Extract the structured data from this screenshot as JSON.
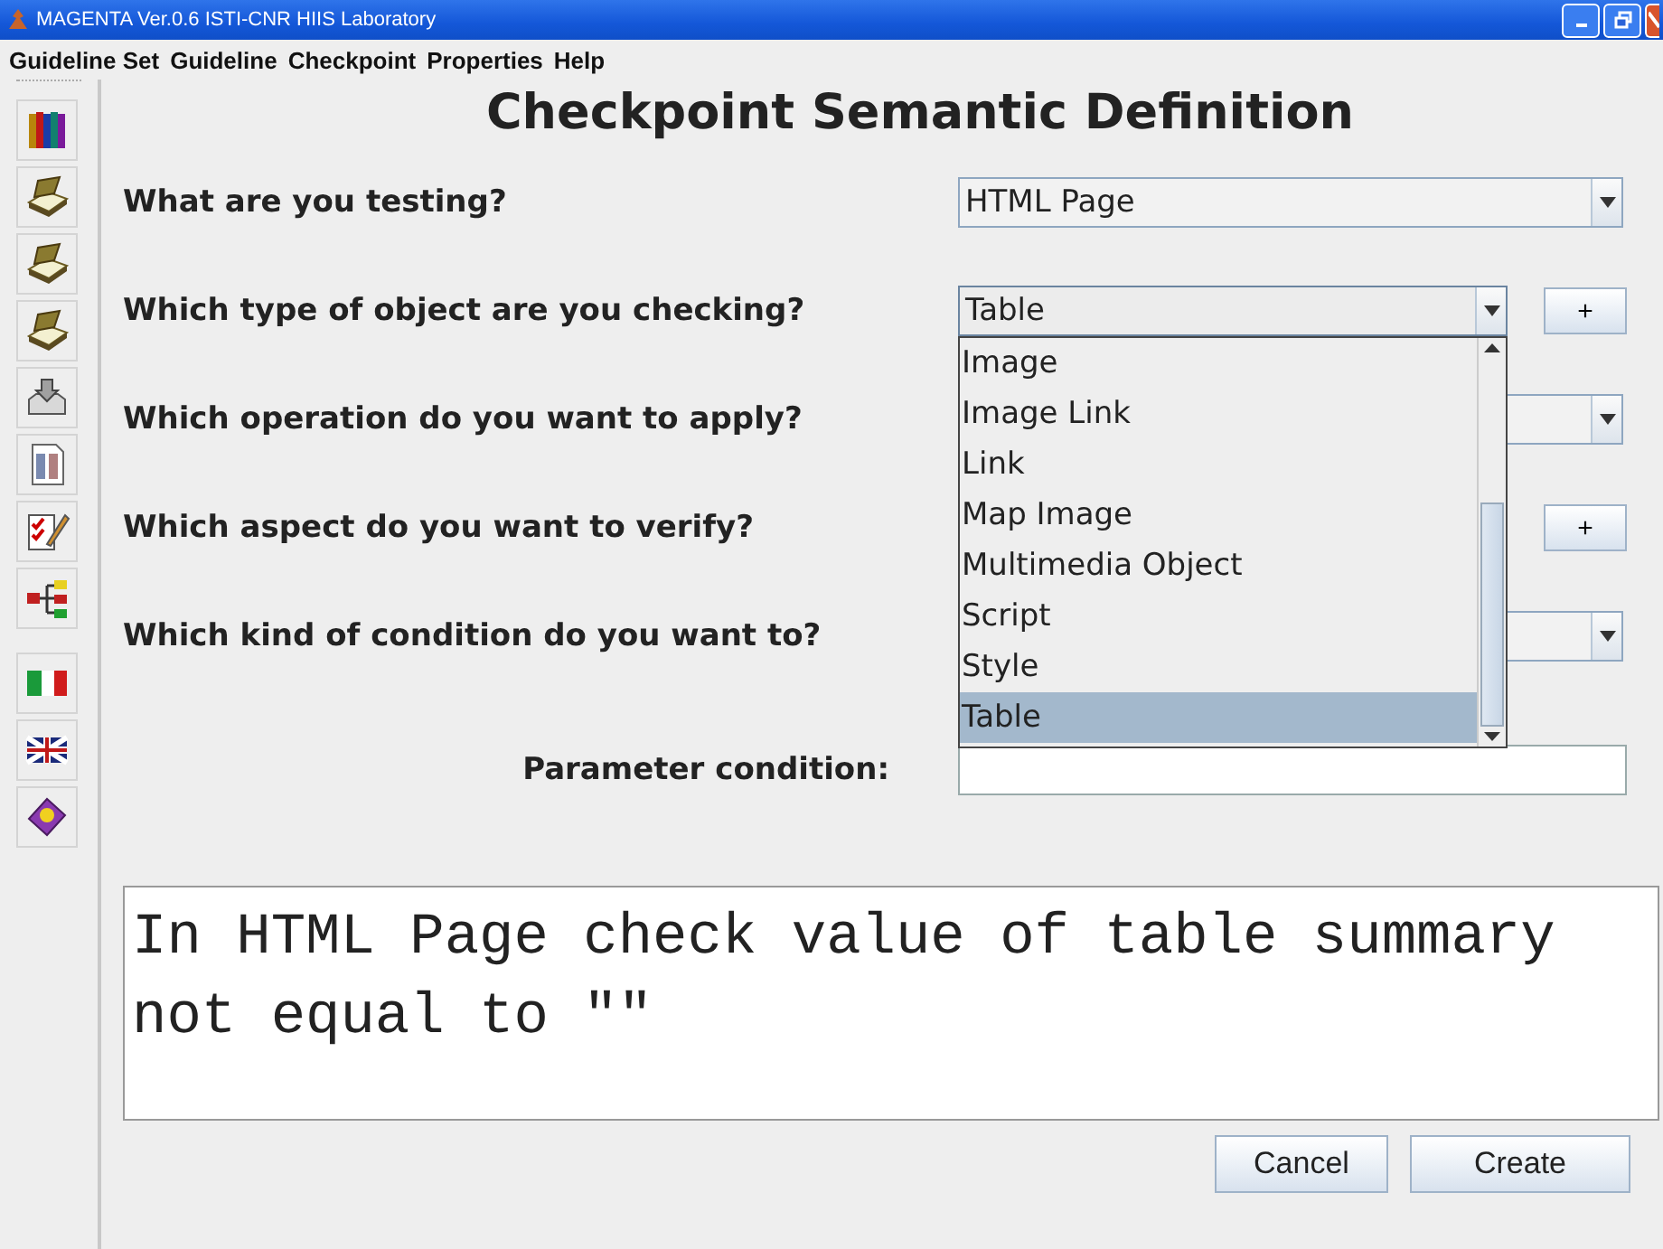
{
  "window": {
    "title": "MAGENTA Ver.0.6 ISTI-CNR HIIS Laboratory"
  },
  "menu": [
    "Guideline Set",
    "Guideline",
    "Checkpoint",
    "Properties",
    "Help"
  ],
  "heading": "Checkpoint Semantic Definition",
  "questions": [
    {
      "kind": "combo",
      "label": "What are you testing?",
      "value": "HTML Page",
      "add_button": false
    },
    {
      "kind": "combo",
      "label": "Which type of object are you checking?",
      "value": "Table",
      "add_button": true,
      "open": true
    },
    {
      "kind": "combo",
      "label": "Which operation do you want to apply?",
      "add_button": false
    },
    {
      "kind": "covered",
      "label": "Which aspect do you want to verify?",
      "add_button": true
    },
    {
      "kind": "combo",
      "label": "Which kind of condition do you want to?",
      "add_button": false
    },
    {
      "kind": "field",
      "label": "Parameter condition:"
    }
  ],
  "add_label": "+",
  "dropdown": [
    {
      "label": "Image",
      "selected": false
    },
    {
      "label": "Image Link",
      "selected": false
    },
    {
      "label": "Link",
      "selected": false
    },
    {
      "label": "Map Image",
      "selected": false
    },
    {
      "label": "Multimedia Object",
      "selected": false
    },
    {
      "label": "Script",
      "selected": false
    },
    {
      "label": "Style",
      "selected": false
    },
    {
      "label": "Table",
      "selected": true
    }
  ],
  "description": "In HTML Page check value of table summary not equal to \"\"",
  "buttons": [
    "Cancel",
    "Create"
  ]
}
